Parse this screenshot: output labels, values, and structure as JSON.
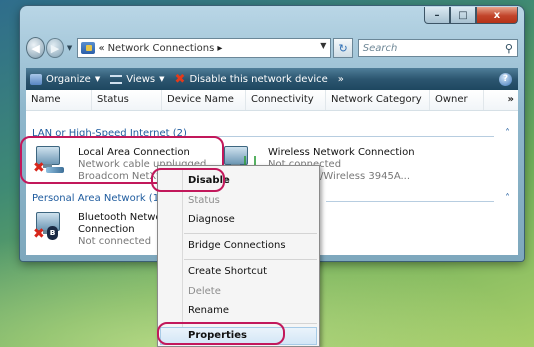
{
  "window": {
    "caption_buttons": {
      "minimize": "–",
      "maximize": "□",
      "close": "x"
    }
  },
  "addressbar": {
    "back_icon": "back-arrow-icon",
    "forward_icon": "forward-arrow-icon",
    "path_prefix": "«",
    "path": "Network Connections",
    "path_arrow": "▸",
    "refresh_icon": "refresh-icon",
    "search_placeholder": "Search"
  },
  "toolbar": {
    "organize": "Organize",
    "views": "Views",
    "disable": "Disable this network device",
    "more": "»",
    "help": "?"
  },
  "columns": [
    "Name",
    "Status",
    "Device Name",
    "Connectivity",
    "Network Category",
    "Owner"
  ],
  "columns_more": "»",
  "groups": {
    "lan": "LAN or High-Speed Internet (2)",
    "pan": "Personal Area Network (1)"
  },
  "connections": {
    "local": {
      "name": "Local Area Connection",
      "status": "Network cable unplugged",
      "device": "Broadcom NetXtr"
    },
    "wireless": {
      "name": "Wireless Network Connection",
      "status": "Not connected",
      "device": "/Wireless 3945A..."
    },
    "bluetooth": {
      "name_line1": "Bluetooth Netwo",
      "name_line2": "Connection",
      "status": "Not connected"
    }
  },
  "context_menu": {
    "disable": "Disable",
    "status": "Status",
    "diagnose": "Diagnose",
    "bridge": "Bridge Connections",
    "shortcut": "Create Shortcut",
    "delete": "Delete",
    "rename": "Rename",
    "properties": "Properties"
  },
  "colors": {
    "highlight": "#c2185b",
    "group_text": "#1e5b9e",
    "toolbar_bg": "#2c5670"
  }
}
